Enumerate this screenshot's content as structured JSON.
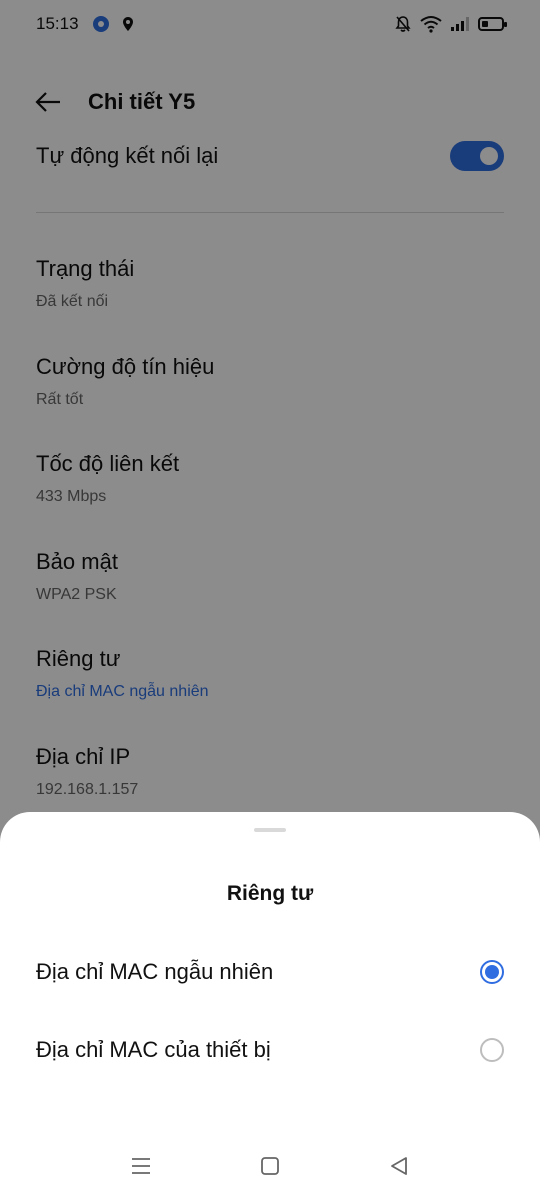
{
  "status_bar": {
    "time": "15:13"
  },
  "app_bar": {
    "title": "Chi tiết Y5"
  },
  "auto_reconnect": {
    "label": "Tự động kết nối lại",
    "enabled": true
  },
  "details": [
    {
      "title": "Trạng thái",
      "value": "Đã kết nối"
    },
    {
      "title": "Cường độ tín hiệu",
      "value": "Rất tốt"
    },
    {
      "title": "Tốc độ liên kết",
      "value": "433 Mbps"
    },
    {
      "title": "Bảo mật",
      "value": "WPA2 PSK"
    },
    {
      "title": "Riêng tư",
      "value": "Địa chỉ MAC ngẫu nhiên"
    },
    {
      "title": "Địa chỉ IP",
      "value": "192.168.1.157"
    }
  ],
  "sheet": {
    "title": "Riêng tư",
    "options": [
      {
        "label": "Địa chỉ MAC ngẫu nhiên",
        "selected": true
      },
      {
        "label": "Địa chỉ MAC của thiết bị",
        "selected": false
      }
    ]
  },
  "colors": {
    "accent": "#2f6de1",
    "scrim": "rgba(0,0,0,0.45)"
  },
  "icons": [
    "gear-icon",
    "location-icon",
    "mute-bell-icon",
    "wifi-icon",
    "signal-icon",
    "battery-icon",
    "back-arrow-icon",
    "menu-icon",
    "home-icon",
    "back-triangle-icon"
  ]
}
